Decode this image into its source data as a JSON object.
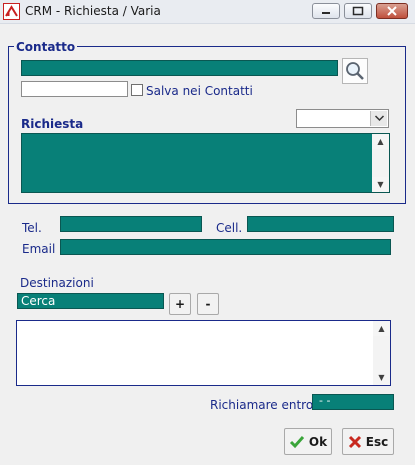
{
  "window": {
    "title": "CRM - Richiesta / Varia",
    "minimize_icon": "minimize-icon",
    "maximize_icon": "maximize-icon",
    "close_icon": "close-icon"
  },
  "contatto": {
    "group_label": "Contatto",
    "name_value": "",
    "secondary_value": "",
    "save_checkbox_label": "Salva nei Contatti",
    "save_checked": false,
    "search_icon": "magnifier-icon"
  },
  "richiesta": {
    "label": "Richiesta",
    "selected_option": "",
    "text_value": ""
  },
  "contacts": {
    "tel_label": "Tel.",
    "tel_value": "",
    "cell_label": "Cell.",
    "cell_value": "",
    "email_label": "Email",
    "email_value": ""
  },
  "destinazioni": {
    "label": "Destinazioni",
    "search_value": "Cerca",
    "add_label": "+",
    "remove_label": "-",
    "list_text": ""
  },
  "richiamare": {
    "label": "Richiamare entro:",
    "date_value": "- -"
  },
  "buttons": {
    "ok_label": "Ok",
    "esc_label": "Esc"
  },
  "colors": {
    "field_teal": "#088078",
    "label_blue": "#1a2a8a",
    "ok_green": "#3aa53a",
    "esc_red": "#c8281e"
  }
}
